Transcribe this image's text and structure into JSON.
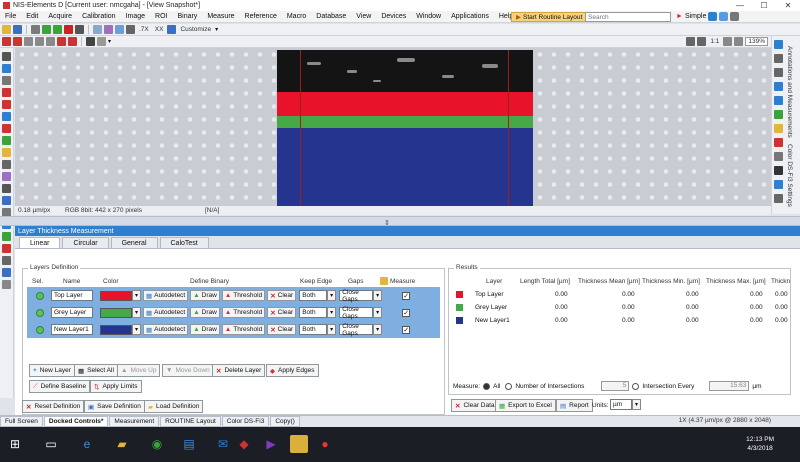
{
  "window": {
    "title": "NIS-Elements D [Current user: nmcgaha] - [View Snapshot*]",
    "minimize": "—",
    "maximize": "☐",
    "close": "✕"
  },
  "menu": {
    "items": [
      "File",
      "Edit",
      "Acquire",
      "Calibration",
      "Image",
      "ROI",
      "Binary",
      "Measure",
      "Reference",
      "Macro",
      "Database",
      "View",
      "Devices",
      "Window",
      "Applications",
      "Help"
    ],
    "routine_button": "Start Routine Layout",
    "search_placeholder": "Search",
    "simple_label": "Simple"
  },
  "toolbar": {
    "customize_label": "Customize",
    "zoom_value": "139%",
    "ratio_label": "1:1",
    "tx1": ".7X",
    "tx2": "XX"
  },
  "view_status": {
    "scale": "0.18 µm/px",
    "image_info": "RGB 8bit: 442 x 270 pixels",
    "na": "[N/A]"
  },
  "right_panel": {
    "tab1": "Annotations and Measurements",
    "tab2": "Color DS-Fi3 Settings"
  },
  "ltm": {
    "title": "Layer Thickness Measurement",
    "tabs": [
      "Linear",
      "Circular",
      "General",
      "CaloTest"
    ],
    "layers_definition_title": "Layers Definition",
    "columns": {
      "sel": "Sel.",
      "name": "Name",
      "color": "Color",
      "define_binary": "Define Binary",
      "keep_edge": "Keep Edge",
      "gaps": "Gaps",
      "measure": "Measure"
    },
    "layers": [
      {
        "name": "Top Layer",
        "color": "#e8132a",
        "keep_edge": "Both",
        "gaps": "Close Gaps",
        "measure": "✓"
      },
      {
        "name": "Grey Layer",
        "color": "#47a847",
        "keep_edge": "Both",
        "gaps": "Close Gaps",
        "measure": "✓"
      },
      {
        "name": "New Layer1",
        "color": "#25348f",
        "keep_edge": "Both",
        "gaps": "Close Gaps",
        "measure": "✓"
      }
    ],
    "row_buttons": {
      "autodetect": "Autodetect",
      "draw": "Draw",
      "threshold": "Threshold",
      "clear": "Clear"
    },
    "actions": {
      "new_layer": "New Layer",
      "select_all": "Select All",
      "move_up": "Move Up",
      "move_down": "Move Down",
      "delete_layer": "Delete Layer",
      "apply_edges": "Apply Edges",
      "define_baseline": "Define Baseline",
      "apply_limits": "Apply Limits",
      "reset_definition": "Reset Definition",
      "save_definition": "Save Definition",
      "load_definition": "Load Definition"
    },
    "results": {
      "title": "Results",
      "columns": [
        "Layer",
        "Length Total [µm]",
        "Thickness Mean [µm]",
        "Thickness Min. [µm]",
        "Thickness Max. [µm]",
        "Thickn"
      ],
      "rows": [
        {
          "name": "Top Layer",
          "color": "#e8132a",
          "values": [
            "0.00",
            "0.00",
            "0.00",
            "0.00",
            "0.00"
          ]
        },
        {
          "name": "Grey Layer",
          "color": "#47a847",
          "values": [
            "0.00",
            "0.00",
            "0.00",
            "0.00",
            "0.00"
          ]
        },
        {
          "name": "New Layer1",
          "color": "#25348f",
          "values": [
            "0.00",
            "0.00",
            "0.00",
            "0.00",
            "0.00"
          ]
        }
      ],
      "measure_label": "Measure:",
      "opt_all": "All",
      "opt_intersections": "Number of Intersections",
      "intersections_value": "5",
      "opt_every": "Intersection Every",
      "every_value": "15.63",
      "every_unit": "µm",
      "clear_data": "Clear Data",
      "export_excel": "Export to Excel",
      "report": "Report",
      "units_label": "Units:",
      "units_value": "µm"
    }
  },
  "doc_tabs": {
    "items": [
      "Full Screen",
      "Docked Controls*",
      "Measurement",
      "ROUTINE Layout",
      "Color DS-Fi3",
      "Copy()"
    ],
    "zoom_info": "1X (4.37 µm/px @ 2880 x 2048)"
  },
  "taskbar": {
    "time": "12:13 PM",
    "date": "4/3/2018"
  }
}
